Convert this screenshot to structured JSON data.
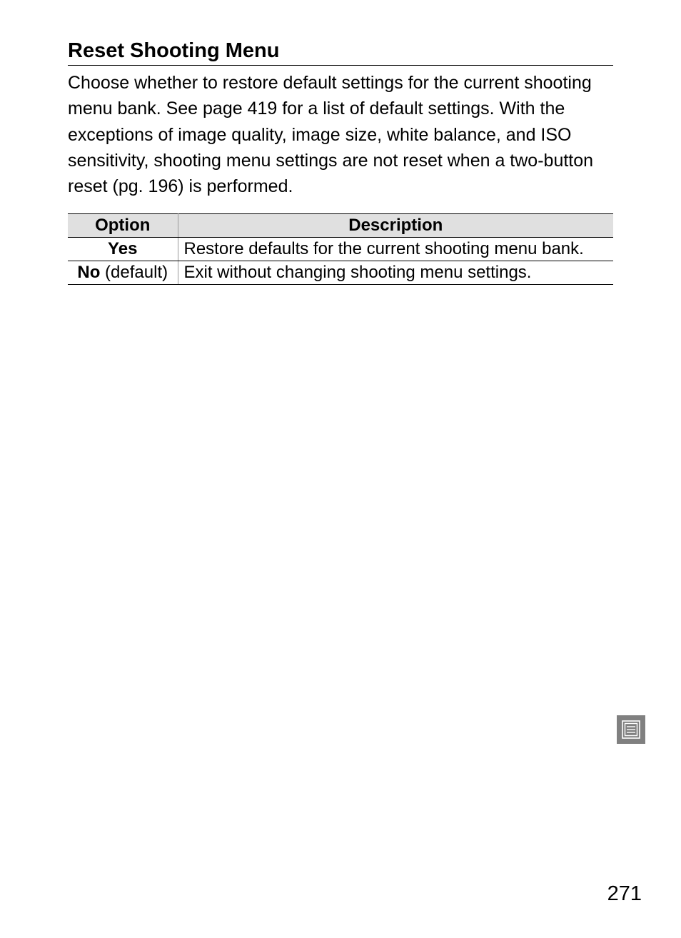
{
  "section": {
    "title": "Reset Shooting Menu",
    "body": "Choose whether to restore default settings for the current shooting menu bank.  See page 419 for a list of default settings.  With the exceptions of image quality, image size, white balance, and ISO sensitivity, shooting menu settings are not reset when a two-button reset (pg. 196) is performed."
  },
  "table": {
    "headers": {
      "option": "Option",
      "description": "Description"
    },
    "rows": [
      {
        "option_bold": "Yes",
        "option_rest": "",
        "description": "Restore defaults for the current shooting menu bank."
      },
      {
        "option_bold": "No",
        "option_rest": " (default)",
        "description": "Exit without changing shooting menu settings."
      }
    ]
  },
  "page_number": "271"
}
